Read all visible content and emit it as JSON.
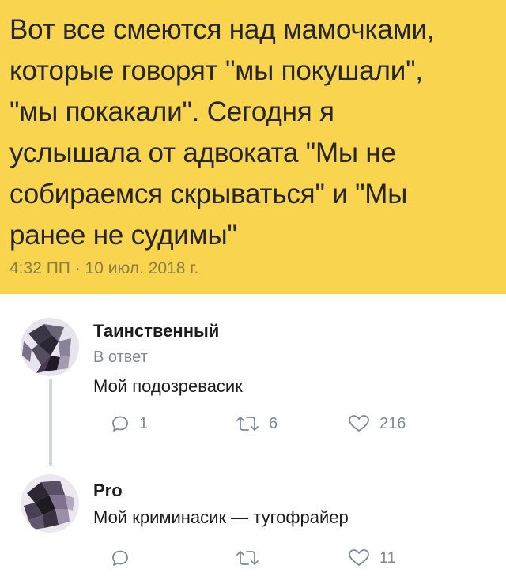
{
  "tweet": {
    "text_lines": [
      "Вот все смеются над мамочками,",
      "которые говорят \"мы покушали\",",
      "\"мы покакали\". Сегодня я",
      "услышала от адвоката \"Мы не",
      "собираемся скрываться\" и \"Мы",
      "ранее не судимы\""
    ],
    "timestamp": "4:32 ПП · 10 июл. 2018 г."
  },
  "replies": [
    {
      "author": "Таинственный",
      "reply_to": "В ответ",
      "text": "Мой подозревасик",
      "actions": {
        "reply_count": "1",
        "retweet_count": "6",
        "like_count": "216"
      }
    },
    {
      "author": "Pro",
      "text": "Мой криминасик — тугофрайер",
      "actions": {
        "reply_count": "",
        "retweet_count": "",
        "like_count": "11"
      }
    }
  ],
  "icons": {
    "reply": "reply-bubble-icon",
    "retweet": "retweet-icon",
    "like": "heart-icon"
  },
  "colors": {
    "tweet_background": "#f9d44f",
    "muted": "#7b8a96",
    "text": "#1c1c1c"
  }
}
